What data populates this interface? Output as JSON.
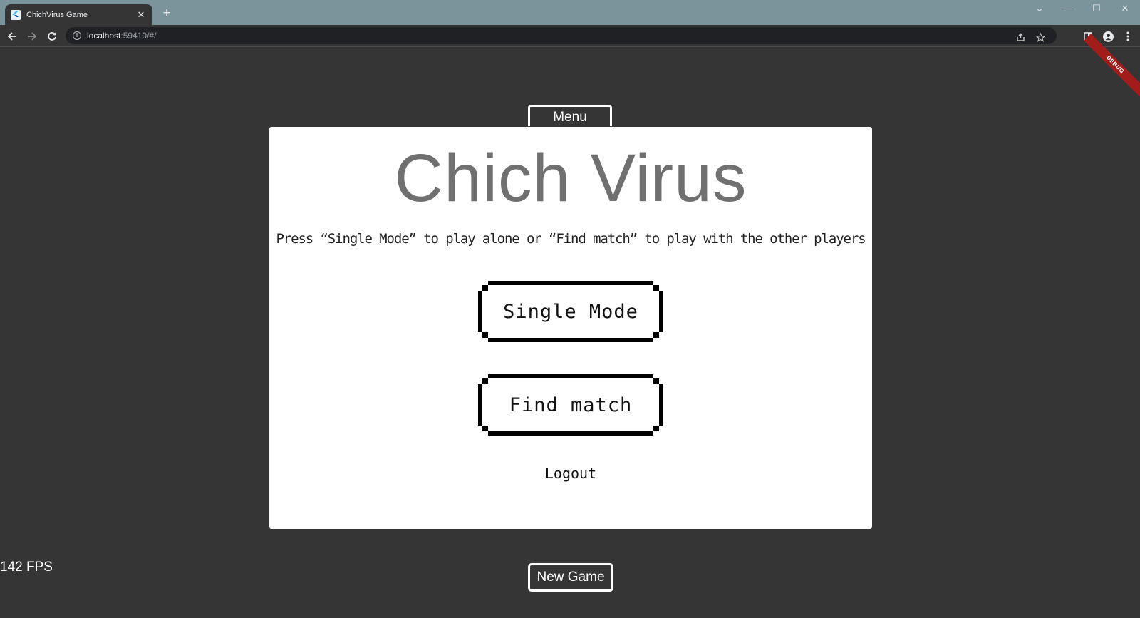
{
  "browser": {
    "tab_title": "ChichVirus Game",
    "tab_close": "✕",
    "new_tab": "+",
    "url_host": "localhost",
    "url_rest": ":59410/#/",
    "window_controls": [
      "⌄",
      "—",
      "☐",
      "✕"
    ],
    "icons": [
      "flutter-icon",
      "back-arrow-icon",
      "forward-arrow-icon",
      "reload-icon",
      "info-icon",
      "share-icon",
      "star-icon",
      "sidepanel-icon",
      "profile-icon",
      "more-vert-icon"
    ]
  },
  "debug_banner": "DEBUG",
  "game": {
    "menu_label": "Menu",
    "title": "Chich Virus",
    "instructions": "Press “Single Mode” to play alone or “Find match” to play with the other players",
    "single_mode_label": "Single Mode",
    "find_match_label": "Find match",
    "logout_label": "Logout",
    "fps": "142 FPS",
    "new_game_label": "New Game"
  },
  "colors": {
    "background": "#353535",
    "tab_strip": "#7b939b",
    "panel": "#ffffff",
    "title_text": "#707070",
    "debug_banner": "#a31c1c"
  }
}
